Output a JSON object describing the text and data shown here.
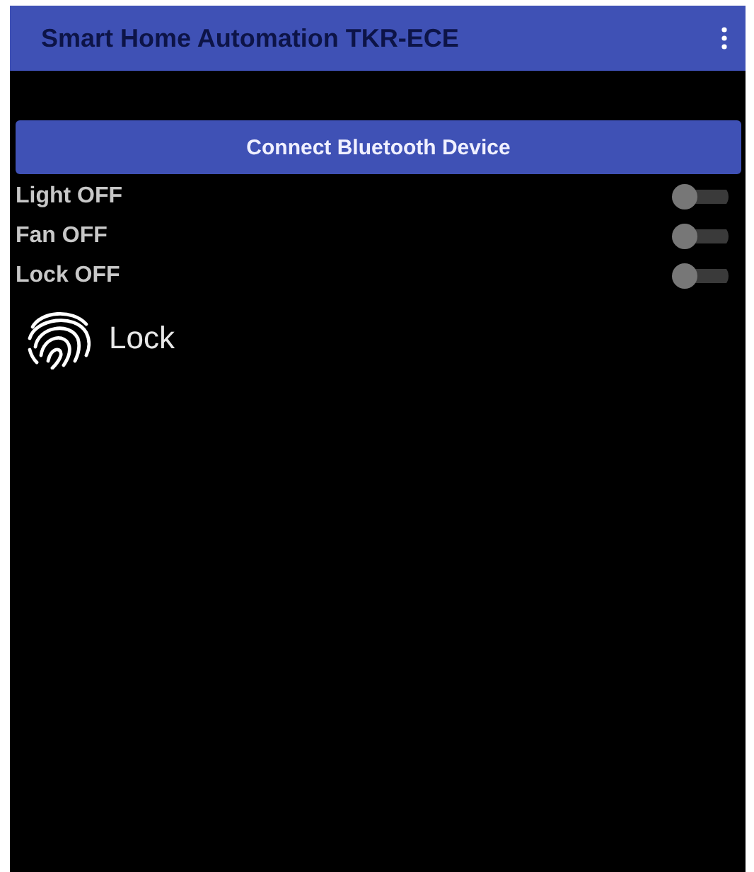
{
  "app_bar": {
    "title": "Smart Home Automation TKR-ECE"
  },
  "connect_button": {
    "label": "Connect Bluetooth Device"
  },
  "switches": [
    {
      "label": "Light OFF",
      "on": false
    },
    {
      "label": "Fan OFF",
      "on": false
    },
    {
      "label": "Lock OFF",
      "on": false
    }
  ],
  "fingerprint": {
    "label": "Lock"
  }
}
